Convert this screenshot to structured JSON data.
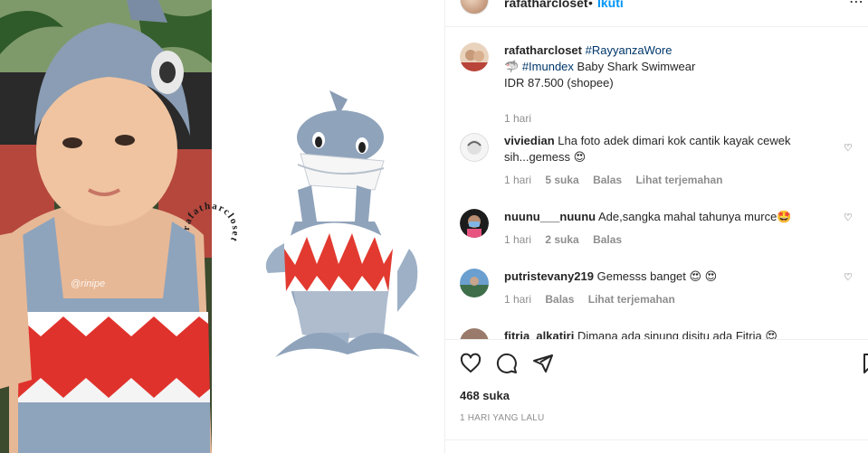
{
  "post_header": {
    "username": "rafatharcloset",
    "separator": "•",
    "follow_label": "Ikuti"
  },
  "photo": {
    "watermark": "@rinipe",
    "logo_text": "rafatharcloset"
  },
  "caption": {
    "username": "rafatharcloset",
    "hashtag1": "#RayyanzaWore",
    "line2_hashtag": "#Imundex",
    "line2_text": "Baby Shark Swimwear",
    "line3": "IDR 87.500 (shopee)",
    "time": "1 hari"
  },
  "comments": [
    {
      "username": "viviedian",
      "text": "Lha foto adek dimari kok cantik kayak cewek sih...gemess 😍",
      "time": "1 hari",
      "likes": "5 suka",
      "reply": "Balas",
      "translate": "Lihat terjemahan"
    },
    {
      "username": "nuunu___nuunu",
      "text": "Ade,sangka mahal tahunya murce🤩",
      "time": "1 hari",
      "likes": "2 suka",
      "reply": "Balas"
    },
    {
      "username": "putristevany219",
      "text": "Gemesss banget 😍 😍",
      "time": "1 hari",
      "reply": "Balas",
      "translate": "Lihat terjemahan"
    },
    {
      "username": "fitria_alkatiri",
      "text": "Dimana ada sinung disitu ada Fitria 😍"
    }
  ],
  "likes_label": "468 suka",
  "date_label": "1 HARI YANG LALU",
  "colors": {
    "link_blue": "#0095f6",
    "hashtag": "#00376b",
    "muted": "#8e8e8e",
    "divider": "#efefef"
  }
}
